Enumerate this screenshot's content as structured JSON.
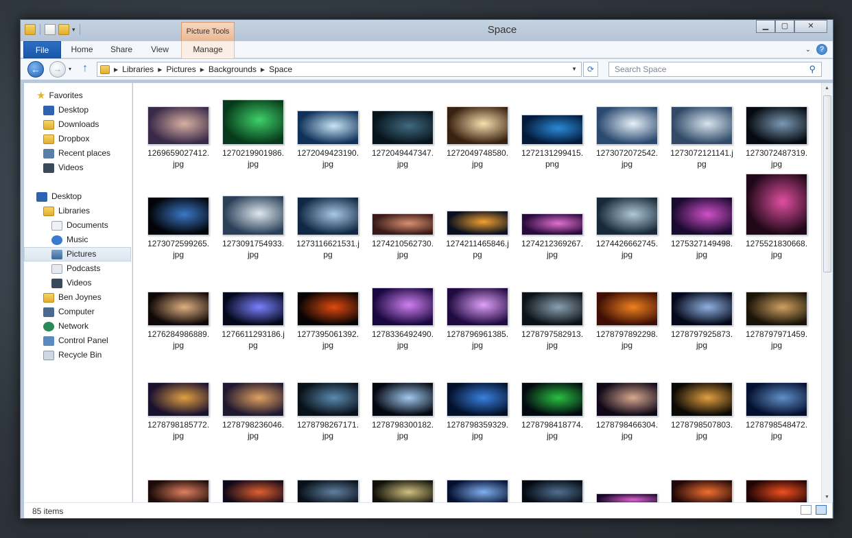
{
  "window": {
    "title": "Space"
  },
  "ribbon": {
    "contextual_group": "Picture Tools",
    "tabs": [
      {
        "label": "File"
      },
      {
        "label": "Home"
      },
      {
        "label": "Share"
      },
      {
        "label": "View"
      },
      {
        "label": "Manage"
      }
    ]
  },
  "address": {
    "crumbs": [
      "Libraries",
      "Pictures",
      "Backgrounds",
      "Space"
    ],
    "search_placeholder": "Search Space"
  },
  "nav": {
    "favorites": {
      "label": "Favorites",
      "items": [
        "Desktop",
        "Downloads",
        "Dropbox",
        "Recent places",
        "Videos"
      ]
    },
    "desktop": "Desktop",
    "libraries": {
      "label": "Libraries",
      "items": [
        "Documents",
        "Music",
        "Pictures",
        "Podcasts",
        "Videos"
      ]
    },
    "others": [
      "Ben Joynes",
      "Computer",
      "Network",
      "Control Panel",
      "Recycle Bin"
    ],
    "selected": "Pictures"
  },
  "files": [
    {
      "name": "1269659027412.jpg",
      "colors": [
        "#3a2a4a",
        "#d8b0a0"
      ]
    },
    {
      "name": "1270219901986.jpg",
      "colors": [
        "#063a1a",
        "#3fd06a"
      ]
    },
    {
      "name": "1272049423190.jpg",
      "colors": [
        "#10325a",
        "#c8e4f6"
      ]
    },
    {
      "name": "1272049447347.jpg",
      "colors": [
        "#07141c",
        "#3f6a80"
      ]
    },
    {
      "name": "1272049748580.jpg",
      "colors": [
        "#3a2210",
        "#f6e0b0"
      ]
    },
    {
      "name": "1272131299415.png",
      "colors": [
        "#031a3a",
        "#2a8ad8"
      ]
    },
    {
      "name": "1273072072542.jpg",
      "colors": [
        "#2a4a70",
        "#e8f0f8"
      ]
    },
    {
      "name": "1273072121141.jpg",
      "colors": [
        "#304a68",
        "#d8e4ee"
      ]
    },
    {
      "name": "1273072487319.jpg",
      "colors": [
        "#060a10",
        "#7a9ab4"
      ]
    },
    {
      "name": "1273072599265.jpg",
      "colors": [
        "#020408",
        "#3a78c8"
      ]
    },
    {
      "name": "1273091754933.jpg",
      "colors": [
        "#2a4058",
        "#dfe8ef"
      ]
    },
    {
      "name": "1273116621531.jpg",
      "colors": [
        "#102844",
        "#a8c8e4"
      ]
    },
    {
      "name": "1274210562730.jpg",
      "colors": [
        "#3a1a18",
        "#d89070"
      ]
    },
    {
      "name": "1274211465846.jpg",
      "colors": [
        "#0a1020",
        "#f0a030"
      ]
    },
    {
      "name": "1274212369267.jpg",
      "colors": [
        "#2a0a3a",
        "#e070d0"
      ]
    },
    {
      "name": "1274426662745.jpg",
      "colors": [
        "#182a3a",
        "#b0c8d8"
      ]
    },
    {
      "name": "1275327149498.jpg",
      "colors": [
        "#1a0a30",
        "#d050c8"
      ]
    },
    {
      "name": "1275521830668.jpg",
      "colors": [
        "#200818",
        "#e050a0"
      ]
    },
    {
      "name": "1276284986889.jpg",
      "colors": [
        "#100808",
        "#e0b080"
      ]
    },
    {
      "name": "1276611293186.jpg",
      "colors": [
        "#04081a",
        "#7a80ff"
      ]
    },
    {
      "name": "1277395061392.jpg",
      "colors": [
        "#080404",
        "#e04a10"
      ]
    },
    {
      "name": "1278336492490.jpg",
      "colors": [
        "#1a0840",
        "#d080f0"
      ]
    },
    {
      "name": "1278796961385.jpg",
      "colors": [
        "#200a40",
        "#e0a0f8"
      ]
    },
    {
      "name": "1278797582913.jpg",
      "colors": [
        "#0c1218",
        "#8aa0b0"
      ]
    },
    {
      "name": "1278797892298.jpg",
      "colors": [
        "#401004",
        "#f08020"
      ]
    },
    {
      "name": "1278797925873.jpg",
      "colors": [
        "#04081a",
        "#90b0e0"
      ]
    },
    {
      "name": "1278797971459.jpg",
      "colors": [
        "#1a1408",
        "#d0a060"
      ]
    },
    {
      "name": "1278798185772.jpg",
      "colors": [
        "#1a1030",
        "#e0a040"
      ]
    },
    {
      "name": "1278798236046.jpg",
      "colors": [
        "#201830",
        "#e0a060"
      ]
    },
    {
      "name": "1278798267171.jpg",
      "colors": [
        "#081018",
        "#5a8ab0"
      ]
    },
    {
      "name": "1278798300182.jpg",
      "colors": [
        "#040810",
        "#a0c8f0"
      ]
    },
    {
      "name": "1278798359329.jpg",
      "colors": [
        "#02102a",
        "#3a80e0"
      ]
    },
    {
      "name": "1278798418774.jpg",
      "colors": [
        "#020a10",
        "#2ac040"
      ]
    },
    {
      "name": "1278798466304.jpg",
      "colors": [
        "#100818",
        "#d8a890"
      ]
    },
    {
      "name": "1278798507803.jpg",
      "colors": [
        "#0c0804",
        "#e0a040"
      ]
    },
    {
      "name": "1278798548472.jpg",
      "colors": [
        "#041030",
        "#6090c8"
      ]
    },
    {
      "name": "",
      "colors": [
        "#1a0a08",
        "#e08060"
      ]
    },
    {
      "name": "",
      "colors": [
        "#100818",
        "#e06030"
      ]
    },
    {
      "name": "",
      "colors": [
        "#081018",
        "#6080a0"
      ]
    },
    {
      "name": "",
      "colors": [
        "#101008",
        "#d0c080"
      ]
    },
    {
      "name": "",
      "colors": [
        "#041030",
        "#80b0f0"
      ]
    },
    {
      "name": "",
      "colors": [
        "#040810",
        "#507090"
      ]
    },
    {
      "name": "",
      "colors": [
        "#180828",
        "#e060d0"
      ]
    },
    {
      "name": "",
      "colors": [
        "#200808",
        "#f07030"
      ]
    },
    {
      "name": "",
      "colors": [
        "#200404",
        "#f05020"
      ]
    }
  ],
  "status": {
    "count": "85 items"
  }
}
